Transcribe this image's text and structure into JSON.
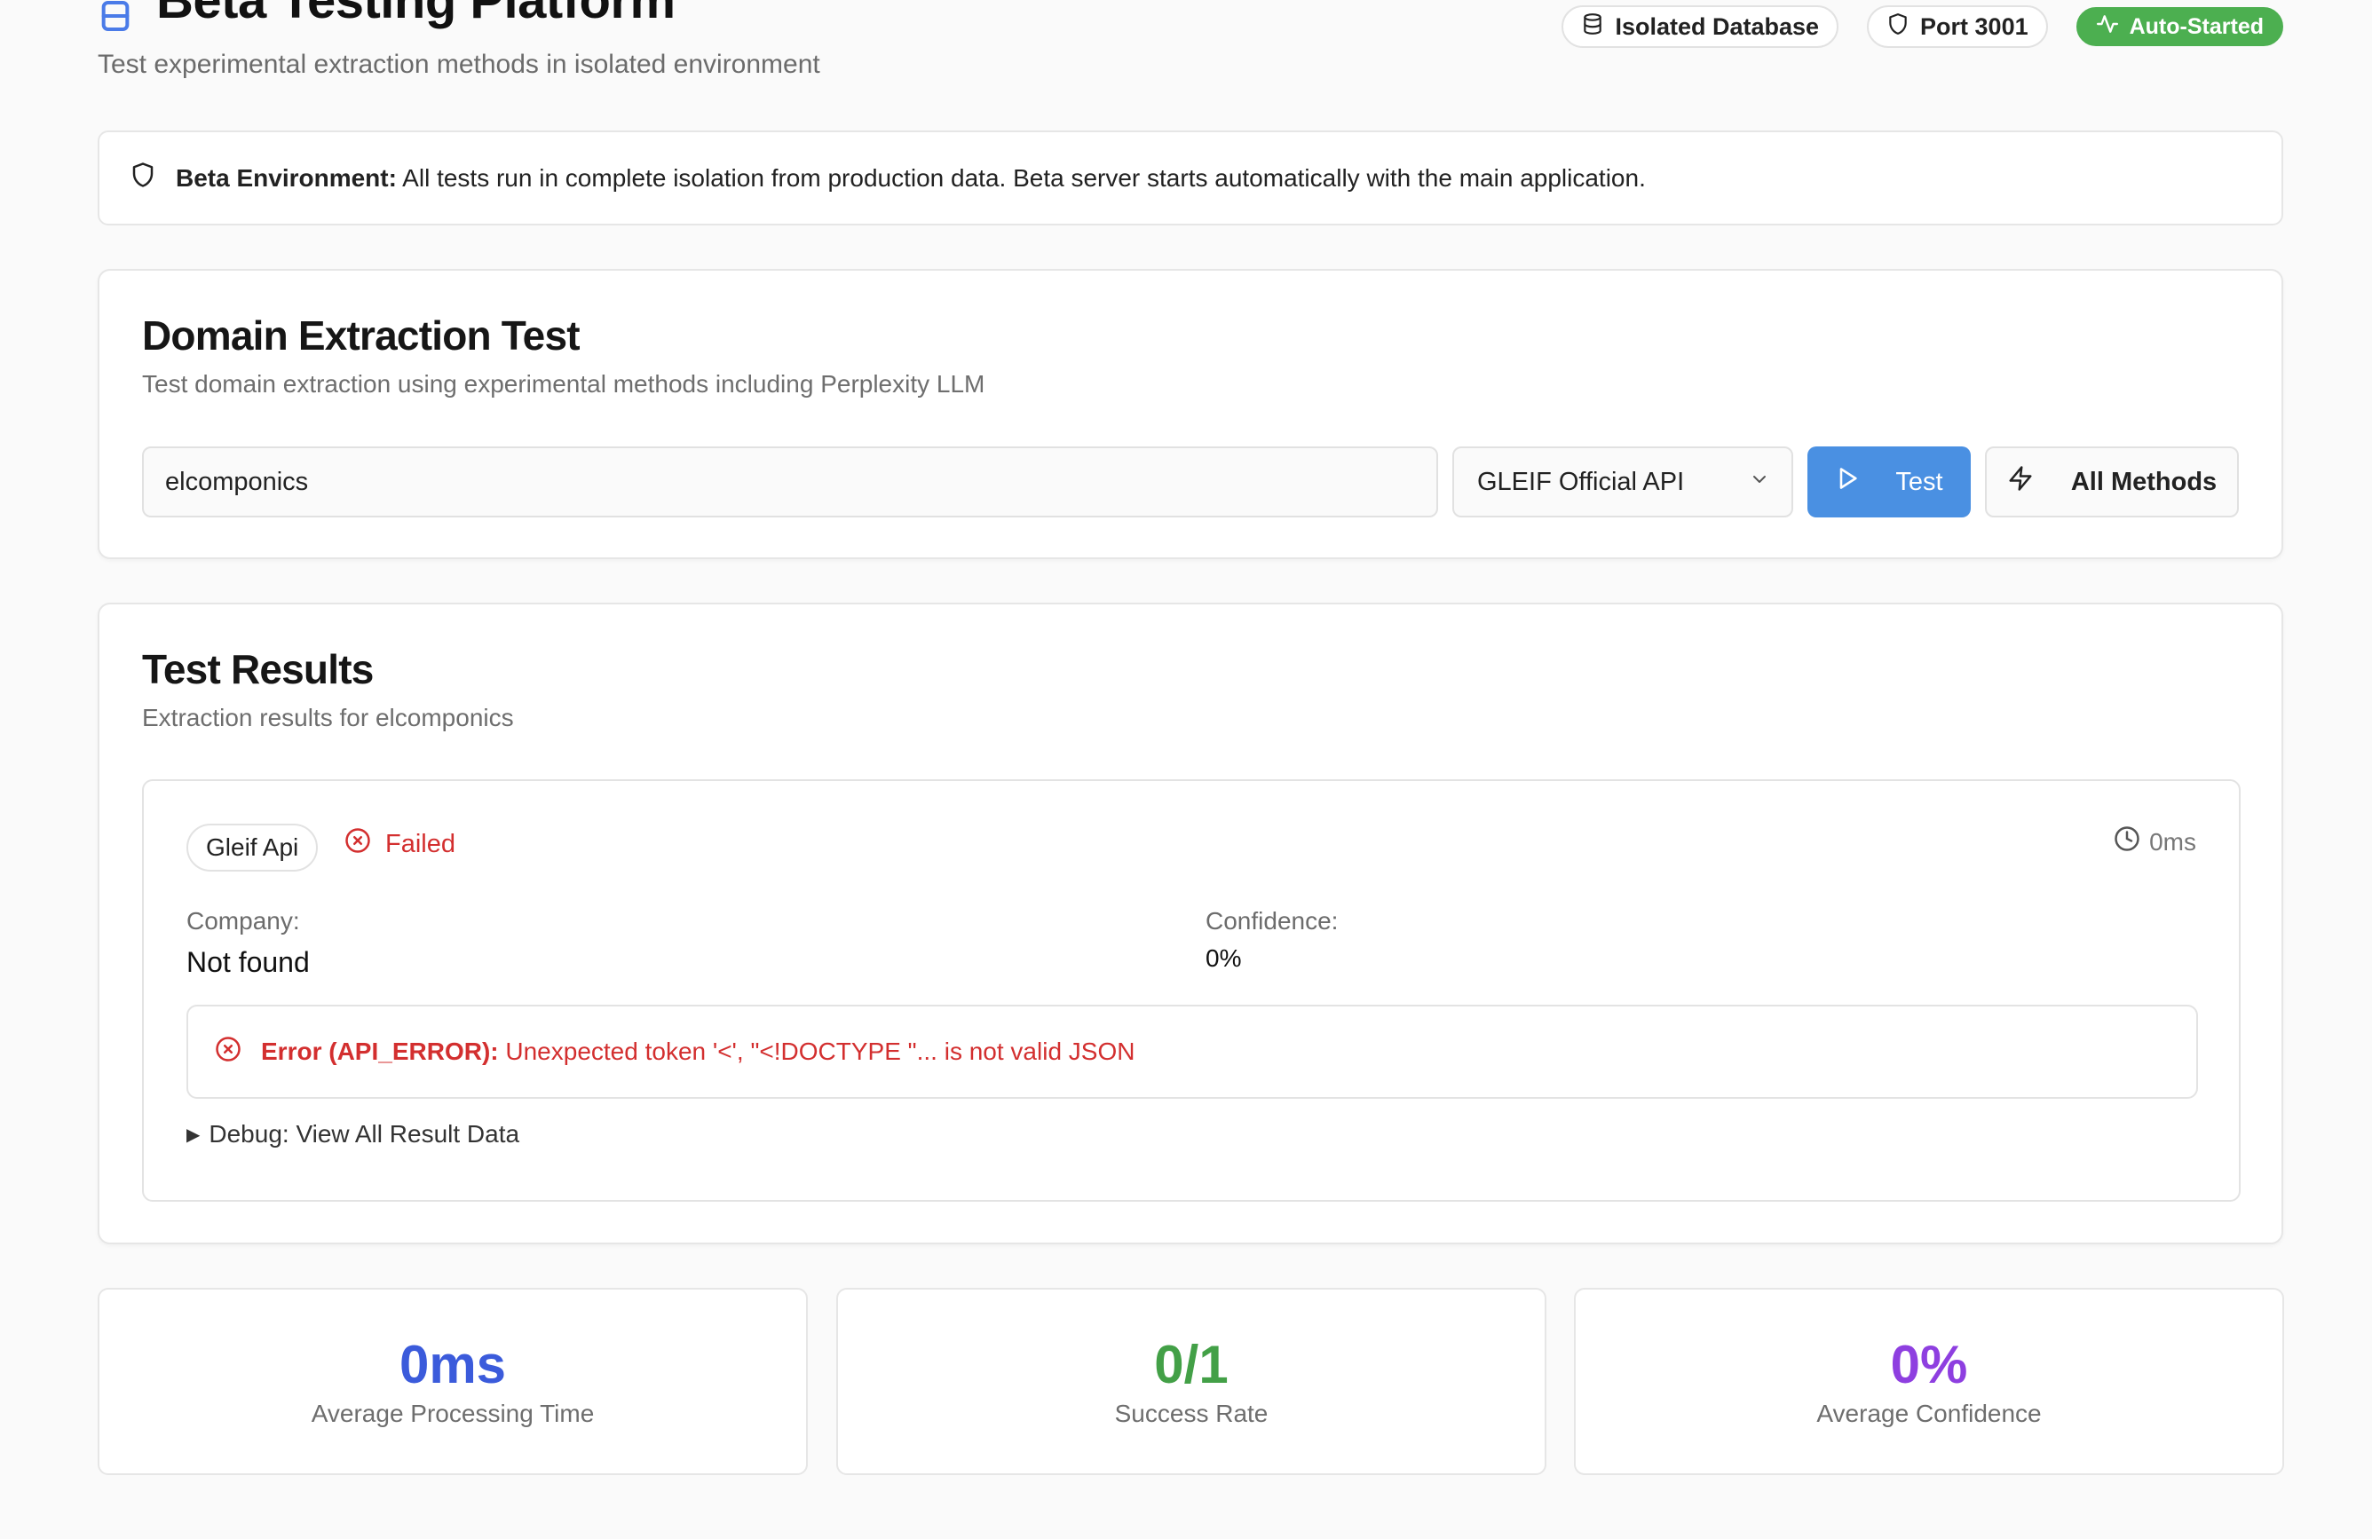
{
  "header": {
    "title": "Beta Testing Platform",
    "subtitle": "Test experimental extraction methods in isolated environment",
    "icon": "flask-icon",
    "badges": [
      {
        "label": "Isolated Database",
        "icon": "database-icon"
      },
      {
        "label": "Port 3001",
        "icon": "shield-icon"
      },
      {
        "label": "Auto-Started",
        "icon": "activity-icon",
        "color": "#4caf50"
      }
    ]
  },
  "alert": {
    "icon": "shield-icon",
    "strong": "Beta Environment:",
    "text": "All tests run in complete isolation from production data. Beta server starts automatically with the main application."
  },
  "extraction": {
    "title": "Domain Extraction Test",
    "description": "Test domain extraction using experimental methods including Perplexity LLM",
    "domain_value": "elcomponics",
    "method_selected": "GLEIF Official API",
    "test_label": "Test",
    "all_methods_label": "All Methods"
  },
  "results": {
    "title": "Test Results",
    "description": "Extraction results for elcomponics",
    "item": {
      "method": "Gleif Api",
      "status": "Failed",
      "time": "0ms",
      "company_label": "Company:",
      "company_value": "Not found",
      "confidence_label": "Confidence:",
      "confidence_value": "0%",
      "error_strong": "Error (API_ERROR):",
      "error_text": "Unexpected token '<', \"<!DOCTYPE \"... is not valid JSON",
      "debug_label": "Debug: View All Result Data"
    }
  },
  "stats": [
    {
      "value": "0ms",
      "label": "Average Processing Time",
      "color": "#3b5bdb"
    },
    {
      "value": "0/1",
      "label": "Success Rate",
      "color": "#43a047"
    },
    {
      "value": "0%",
      "label": "Average Confidence",
      "color": "#8e3fe0"
    }
  ],
  "colors": {
    "accent": "#4a90e2",
    "error": "#d32f2f",
    "success": "#4caf50"
  }
}
